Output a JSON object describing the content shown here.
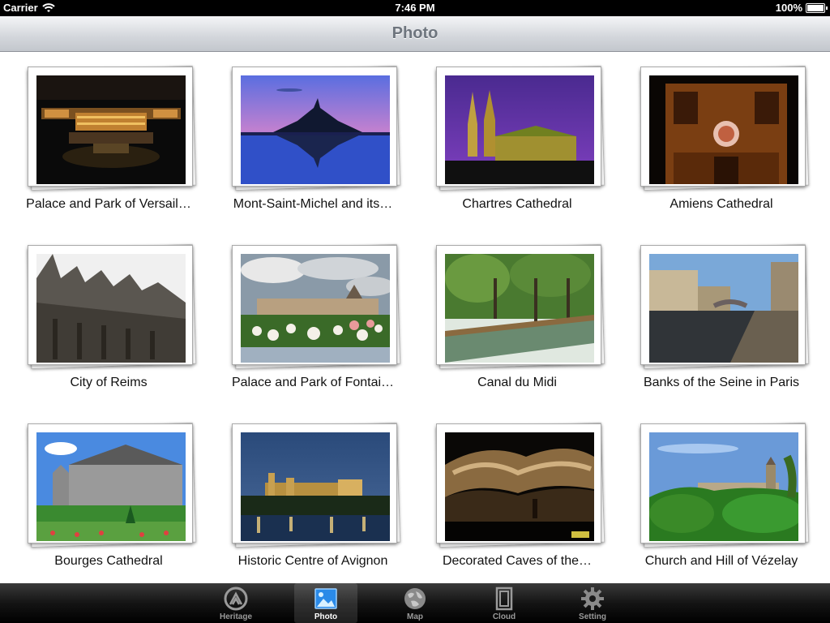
{
  "status_bar": {
    "carrier": "Carrier",
    "time": "7:46 PM",
    "battery": "100%"
  },
  "nav": {
    "title": "Photo"
  },
  "photos": [
    {
      "caption": "Palace and Park of Versail…"
    },
    {
      "caption": "Mont-Saint-Michel and its…"
    },
    {
      "caption": "Chartres Cathedral"
    },
    {
      "caption": "Amiens Cathedral"
    },
    {
      "caption": "City of Reims"
    },
    {
      "caption": "Palace and Park of Fontai…"
    },
    {
      "caption": "Canal du Midi"
    },
    {
      "caption": "Banks of the Seine in Paris"
    },
    {
      "caption": "Bourges Cathedral"
    },
    {
      "caption": "Historic Centre of Avignon"
    },
    {
      "caption": "Decorated Caves of the…"
    },
    {
      "caption": "Church and Hill of Vézelay"
    }
  ],
  "tabs": [
    {
      "label": "Heritage",
      "icon": "heritage-icon",
      "active": false
    },
    {
      "label": "Photo",
      "icon": "photo-icon",
      "active": true
    },
    {
      "label": "Map",
      "icon": "globe-icon",
      "active": false
    },
    {
      "label": "Cloud",
      "icon": "cloud-icon",
      "active": false
    },
    {
      "label": "Setting",
      "icon": "gear-icon",
      "active": false
    }
  ]
}
